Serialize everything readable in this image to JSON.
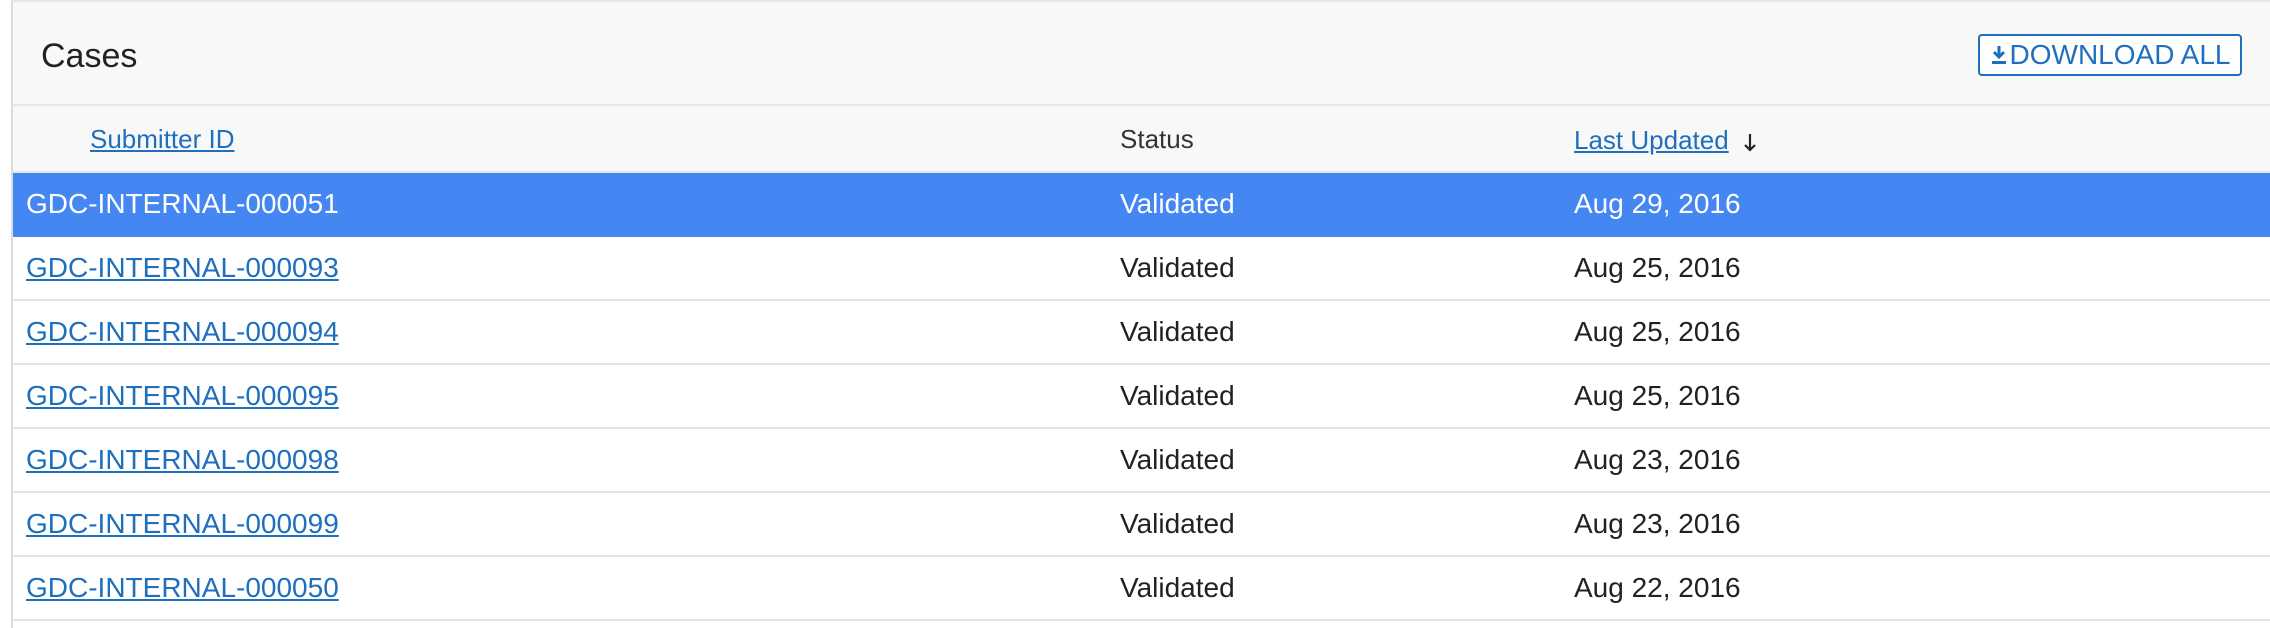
{
  "panel": {
    "title": "Cases",
    "download_label": "DOWNLOAD ALL",
    "download_icon": "download-icon"
  },
  "table": {
    "columns": {
      "submitter_id": "Submitter ID",
      "status": "Status",
      "last_updated": "Last Updated",
      "sort_icon": "arrow-down-icon"
    },
    "rows": [
      {
        "submitter_id": "GDC-INTERNAL-000051",
        "status": "Validated",
        "last_updated": "Aug 29, 2016",
        "selected": true
      },
      {
        "submitter_id": "GDC-INTERNAL-000093",
        "status": "Validated",
        "last_updated": "Aug 25, 2016",
        "selected": false
      },
      {
        "submitter_id": "GDC-INTERNAL-000094",
        "status": "Validated",
        "last_updated": "Aug 25, 2016",
        "selected": false
      },
      {
        "submitter_id": "GDC-INTERNAL-000095",
        "status": "Validated",
        "last_updated": "Aug 25, 2016",
        "selected": false
      },
      {
        "submitter_id": "GDC-INTERNAL-000098",
        "status": "Validated",
        "last_updated": "Aug 23, 2016",
        "selected": false
      },
      {
        "submitter_id": "GDC-INTERNAL-000099",
        "status": "Validated",
        "last_updated": "Aug 23, 2016",
        "selected": false
      },
      {
        "submitter_id": "GDC-INTERNAL-000050",
        "status": "Validated",
        "last_updated": "Aug 22, 2016",
        "selected": false
      }
    ]
  },
  "colors": {
    "link": "#1f6fbf",
    "selected_row": "#4487f2",
    "header_bg": "#f8f8f8"
  }
}
